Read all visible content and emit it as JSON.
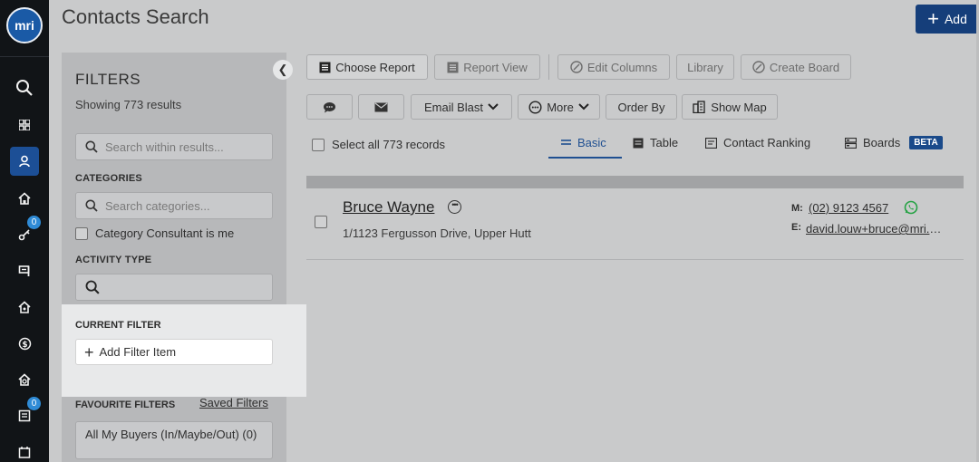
{
  "app": {
    "logo_text": "mri",
    "page_title": "Contacts Search",
    "add_label": "Add"
  },
  "rail": {
    "items": [
      {
        "icon": "search-icon"
      },
      {
        "icon": "grid-icon"
      },
      {
        "icon": "person-icon",
        "active": true
      },
      {
        "icon": "home-icon"
      },
      {
        "icon": "key-icon",
        "badge": "0"
      },
      {
        "icon": "sign-icon"
      },
      {
        "icon": "house-icon"
      },
      {
        "icon": "dollar-icon"
      },
      {
        "icon": "house-settings-icon"
      },
      {
        "icon": "list-icon",
        "badge": "0"
      },
      {
        "icon": "calendar-icon"
      }
    ]
  },
  "filters": {
    "title": "FILTERS",
    "results_count": "Showing 773 results",
    "search_placeholder": "Search within results...",
    "categories_heading": "CATEGORIES",
    "categories_placeholder": "Search categories...",
    "consultant_checkbox": "Category Consultant is me",
    "activity_heading": "ACTIVITY TYPE",
    "current_filter_heading": "CURRENT FILTER",
    "add_filter_label": "Add Filter Item",
    "favourite_heading": "FAVOURITE FILTERS",
    "saved_filters_link": "Saved Filters",
    "favourite_items": [
      "All My Buyers (In/Maybe/Out) (0)"
    ]
  },
  "toolbar": {
    "choose_report": "Choose Report",
    "report_view": "Report View",
    "edit_columns": "Edit Columns",
    "library": "Library",
    "create_board": "Create Board",
    "email_blast": "Email Blast",
    "more": "More",
    "order_by": "Order By",
    "show_map": "Show Map"
  },
  "list": {
    "select_all": "Select all 773 records",
    "tabs": [
      {
        "label": "Basic",
        "active": true
      },
      {
        "label": "Table"
      },
      {
        "label": "Contact Ranking"
      },
      {
        "label": "Boards",
        "badge": "BETA"
      }
    ],
    "contacts": [
      {
        "name": "Bruce Wayne",
        "address": "1/1123 Fergusson Drive, Upper Hutt",
        "mobile_label": "M:",
        "mobile": "(02) 9123 4567",
        "email_label": "E:",
        "email": "david.louw+bruce@mri.com"
      }
    ]
  },
  "colors": {
    "brand_blue": "#153e7a",
    "active_tab": "#1f4f91",
    "whatsapp_green": "#25a244"
  }
}
